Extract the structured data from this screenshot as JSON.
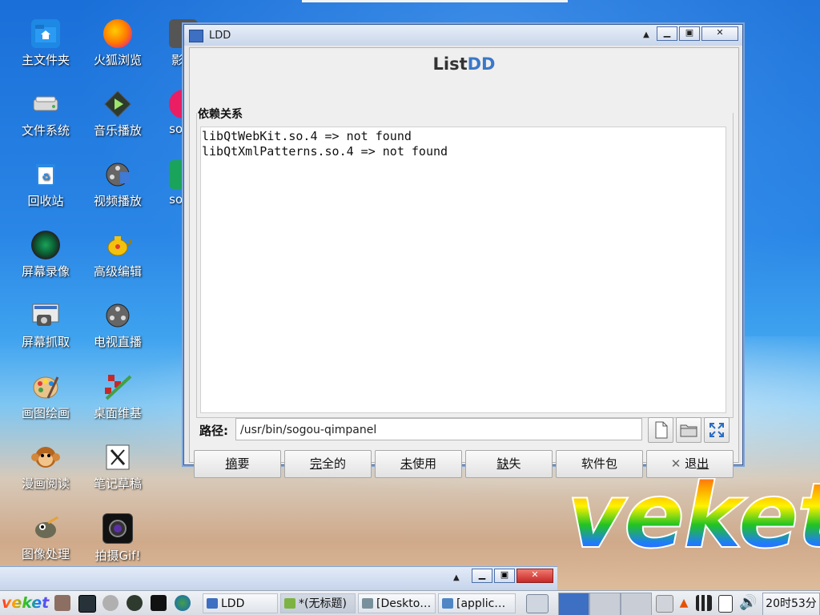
{
  "desktop": {
    "icons_col1": [
      "主文件夹",
      "文件系统",
      "回收站",
      "屏幕录像",
      "屏幕抓取",
      "画图绘画",
      "漫画阅读",
      "图像处理"
    ],
    "icons_col2": [
      "火狐浏览",
      "音乐播放",
      "视频播放",
      "高级编辑",
      "电视直播",
      "桌面维基",
      "笔记草稿",
      "拍摄Gif!"
    ],
    "icons_col3": [
      "影音",
      "sogo",
      "sogo"
    ],
    "logo_text": "veket"
  },
  "ldd_window": {
    "title": "LDD",
    "app_title_a": "List",
    "app_title_b": "DD",
    "group_label": "依赖关系",
    "dependencies": [
      "libQtWebKit.so.4 => not found",
      "libQtXmlPatterns.so.4 => not found"
    ],
    "path_label": "路径:",
    "path_value": "/usr/bin/sogou-qimpanel",
    "buttons": {
      "summary_a": "摘",
      "summary_b": "要",
      "complete_a": "完",
      "complete_b": "全的",
      "unused_a": "未",
      "unused_b": "使用",
      "missing_a": "缺",
      "missing_b": "失",
      "package": "软件包",
      "exit_a": "退",
      "exit_b": "出"
    }
  },
  "taskbar": {
    "start_label": "veket",
    "tasks": [
      "LDD",
      "*(无标题)",
      "[Deskto…",
      "[applic…"
    ],
    "clock": "20时53分"
  }
}
